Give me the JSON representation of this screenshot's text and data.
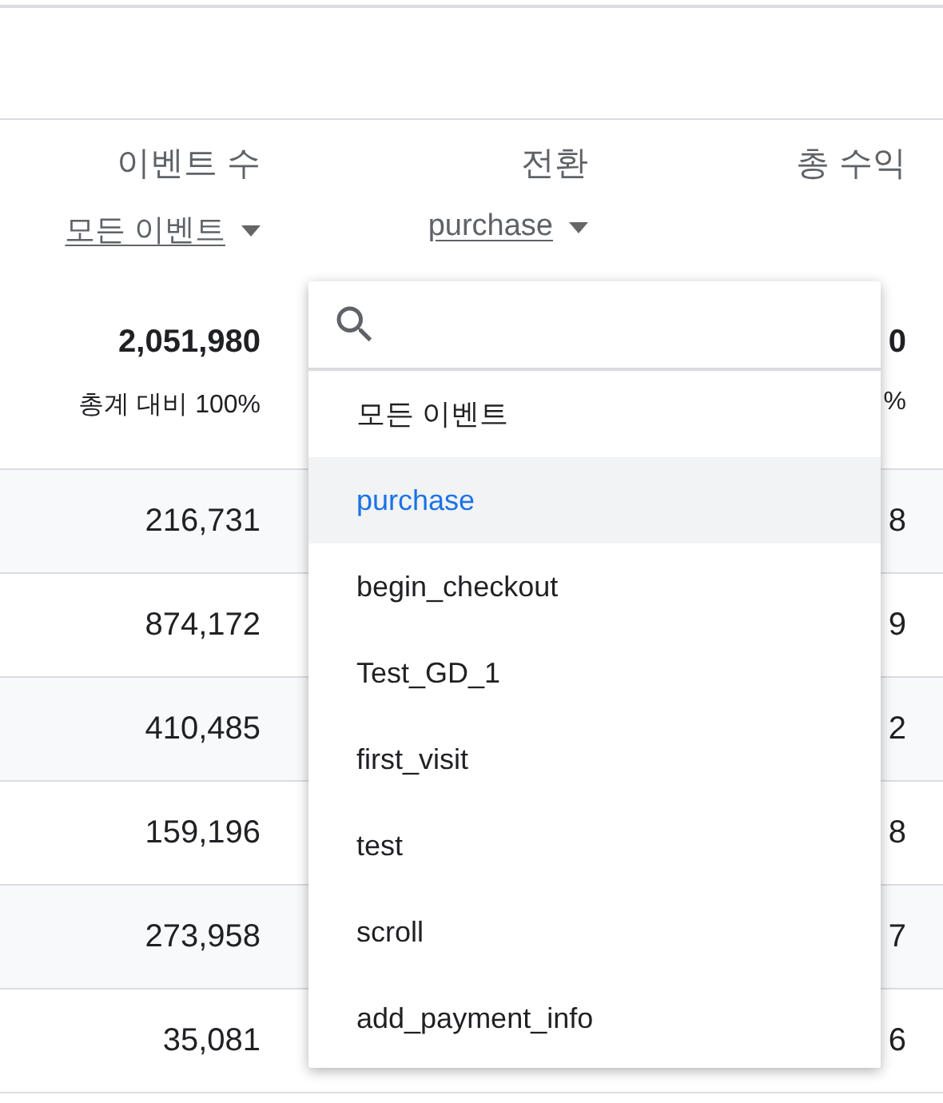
{
  "columns": [
    {
      "title": "이벤트 수",
      "selector": "모든 이벤트"
    },
    {
      "title": "전환",
      "selector": "purchase"
    },
    {
      "title": "총 수익"
    }
  ],
  "totals": [
    {
      "value": "2,051,980",
      "share": "총계 대비 100%"
    },
    {
      "value": "0",
      "share": "%"
    }
  ],
  "rows": [
    {
      "events": "216,731",
      "revenue": "8"
    },
    {
      "events": "874,172",
      "revenue": "9"
    },
    {
      "events": "410,485",
      "revenue": "2"
    },
    {
      "events": "159,196",
      "revenue": "8"
    },
    {
      "events": "273,958",
      "revenue": "7"
    },
    {
      "events": "35,081",
      "revenue": "6"
    }
  ],
  "dropdown": {
    "items": [
      {
        "label": "모든 이벤트",
        "selected": false
      },
      {
        "label": "purchase",
        "selected": true
      },
      {
        "label": "begin_checkout",
        "selected": false
      },
      {
        "label": "Test_GD_1",
        "selected": false
      },
      {
        "label": "first_visit",
        "selected": false
      },
      {
        "label": "test",
        "selected": false
      },
      {
        "label": "scroll",
        "selected": false
      },
      {
        "label": "add_payment_info",
        "selected": false
      }
    ]
  }
}
